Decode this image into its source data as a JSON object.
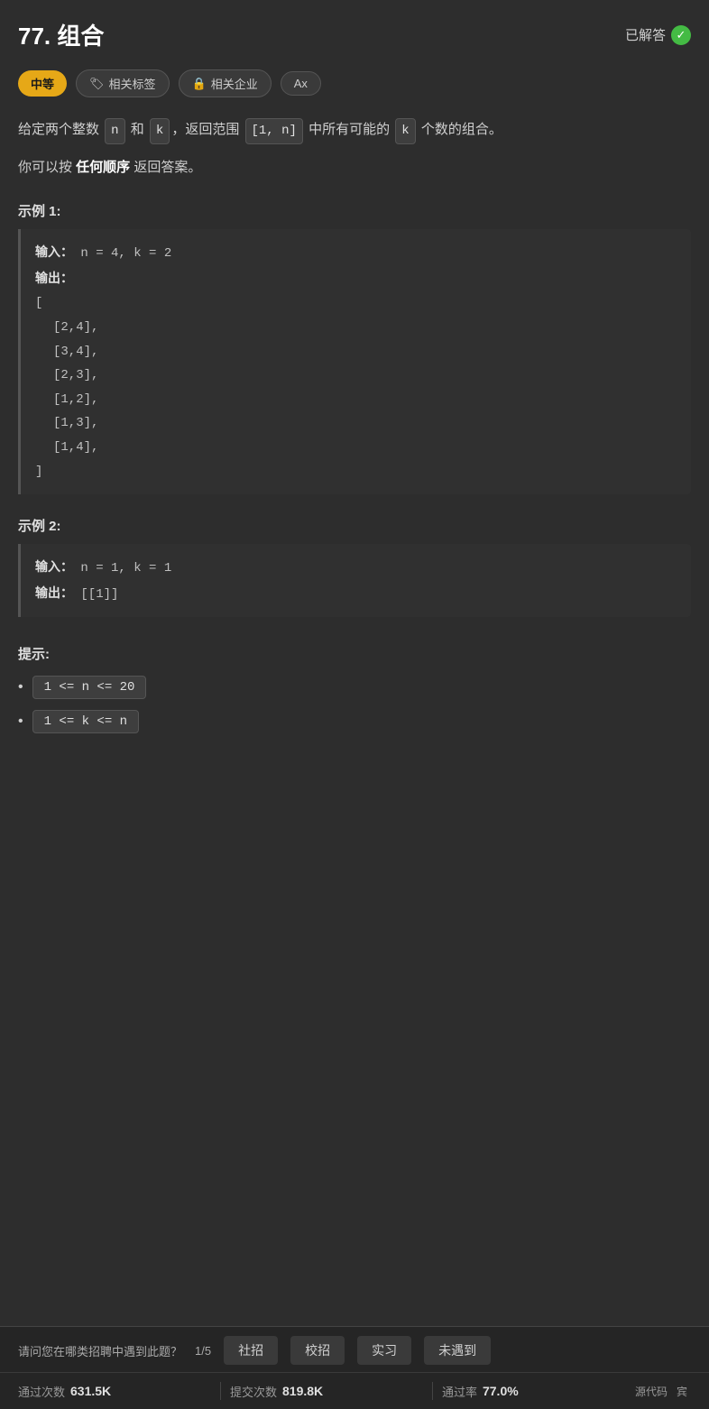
{
  "header": {
    "title": "77. 组合",
    "solved_label": "已解答"
  },
  "tags": [
    {
      "id": "difficulty",
      "label": "中等",
      "type": "difficulty"
    },
    {
      "id": "related-tags",
      "label": "相关标签",
      "type": "related",
      "icon": "tag"
    },
    {
      "id": "related-company",
      "label": "相关企业",
      "type": "company",
      "icon": "lock"
    },
    {
      "id": "lang",
      "label": "Ax",
      "type": "lang"
    }
  ],
  "description": {
    "line1": "给定两个整数 n 和 k，返回范围 [1, n] 中所有可能的 k 个数的组合。",
    "line2": "你可以按 任何顺序 返回答案。"
  },
  "examples": [
    {
      "title": "示例 1:",
      "input_label": "输入：",
      "input_value": "n = 4, k = 2",
      "output_label": "输出：",
      "output_lines": [
        "[",
        "  [2,4],",
        "  [3,4],",
        "  [2,3],",
        "  [1,2],",
        "  [1,3],",
        "  [1,4],",
        "]"
      ]
    },
    {
      "title": "示例 2:",
      "input_label": "输入：",
      "input_value": "n = 1, k = 1",
      "output_label": "输出：",
      "output_value": "[[1]]"
    }
  ],
  "hints": {
    "title": "提示:",
    "items": [
      "1 <= n <= 20",
      "1 <= k <= n"
    ]
  },
  "recruitment": {
    "label": "请问您在哪类招聘中遇到此题？",
    "counter": "1/5",
    "buttons": [
      "社招",
      "校招",
      "实习",
      "未遇到"
    ]
  },
  "stats": [
    {
      "label": "通过次数",
      "value": "631.5K"
    },
    {
      "label": "提交次数",
      "value": "819.8K"
    },
    {
      "label": "通过率",
      "value": "77.0%"
    }
  ],
  "source_links": [
    "源代码",
    "宾"
  ]
}
